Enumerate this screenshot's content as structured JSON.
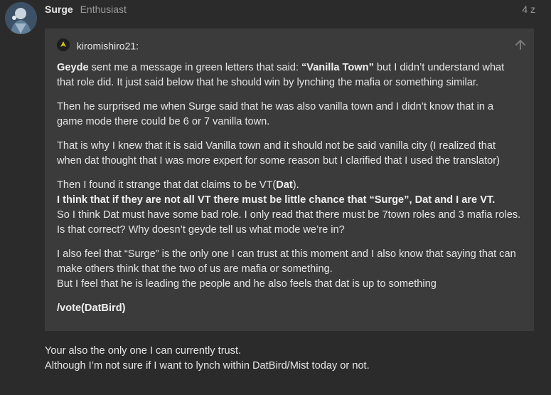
{
  "post": {
    "username": "Surge",
    "user_title": "Enthusiast",
    "date": "4 z"
  },
  "quote": {
    "author": "kiromishiro21:",
    "p1_b1": "Geyde",
    "p1_t1": " sent me a message in green letters that said: ",
    "p1_b2": "“Vanilla Town”",
    "p1_t2": " but I didn’t understand what that role did. It just said below that he should win by lynching the mafia or something similar.",
    "p2": "Then he surprised me when Surge said that he was also vanilla town and I didn’t know that in a game mode there could be 6 or 7 vanilla town.",
    "p3": "That is why I knew that it is said Vanilla town and it should not be said vanilla city (I realized that when dat thought that I was more expert for some reason but I clarified that I used the translator)",
    "p4_t1": "Then I found it strange that dat claims to be VT(",
    "p4_b1": "Dat",
    "p4_t2": ").",
    "p4_b2": "I think that if they are not all VT there must be little chance that “Surge”, Dat and I are VT.",
    "p4_t3": "So I think Dat must have some bad role. I only read that there must be 7town roles and 3 mafia roles. Is that correct? Why doesn’t geyde tell us what mode we’re in?",
    "p5_l1": "I also feel that “Surge” is the only one I can trust at this moment and I also know that saying that can make others think that the two of us are mafia or something.",
    "p5_l2": "But I feel that he is leading the people and he also feels that dat is up to something",
    "p6": "/vote(DatBird)"
  },
  "reply": {
    "line1": "Your also the only one I can currently trust.",
    "line2": "Although I’m not sure if I want to lynch within DatBird/Mist today or not."
  },
  "icons": {
    "avatar": "user-avatar",
    "quote_avatar": "quoted-user-avatar",
    "jump": "arrow-up-icon"
  },
  "colors": {
    "background": "#2b2b2b",
    "quote_background": "#3b3b3b",
    "text": "#e6e6e6",
    "muted": "#9a9a9a"
  }
}
